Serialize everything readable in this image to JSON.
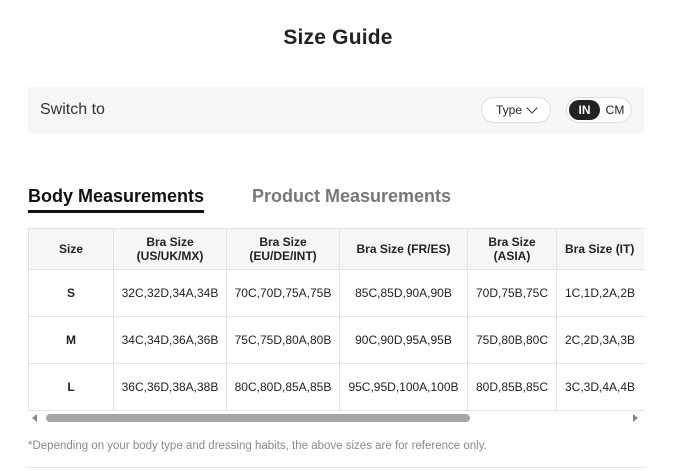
{
  "title": "Size Guide",
  "switch": {
    "label": "Switch to",
    "type_label": "Type",
    "units": {
      "in": "IN",
      "cm": "CM",
      "selected": "IN"
    }
  },
  "tabs": [
    {
      "label": "Body Measurements",
      "active": true
    },
    {
      "label": "Product Measurements",
      "active": false
    }
  ],
  "table": {
    "headers": [
      "Size",
      "Bra Size\n(US/UK/MX)",
      "Bra Size\n(EU/DE/INT)",
      "Bra Size (FR/ES)",
      "Bra Size\n(ASIA)",
      "Bra Size (IT)"
    ],
    "rows": [
      [
        "S",
        "32C,32D,34A,34B",
        "70C,70D,75A,75B",
        "85C,85D,90A,90B",
        "70D,75B,75C",
        "1C,1D,2A,2B"
      ],
      [
        "M",
        "34C,34D,36A,36B",
        "75C,75D,80A,80B",
        "90C,90D,95A,95B",
        "75D,80B,80C",
        "2C,2D,3A,3B"
      ],
      [
        "L",
        "36C,36D,38A,38B",
        "80C,80D,85A,85B",
        "95C,95D,100A,100B",
        "80D,85B,85C",
        "3C,3D,4A,4B"
      ]
    ]
  },
  "note": "*Depending on your body type and dressing habits, the above sizes are for reference only.",
  "icons": [
    "chevron-down-icon",
    "scroll-left-arrow-icon",
    "scroll-right-arrow-icon"
  ]
}
